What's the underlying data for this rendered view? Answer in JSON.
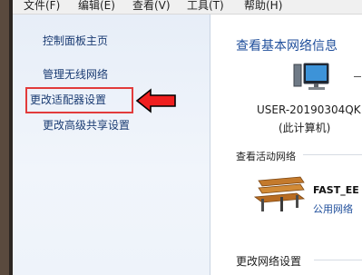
{
  "menubar": {
    "items": [
      "文件(F)",
      "编辑(E)",
      "查看(V)",
      "工具(T)",
      "帮助(H)"
    ]
  },
  "left_nav": {
    "items": [
      "控制面板主页",
      "管理无线网络",
      "更改适配器设置",
      "更改高级共享设置"
    ],
    "highlighted_index": 2
  },
  "main": {
    "title": "查看基本网络信息",
    "computer_name": "USER-20190304QK",
    "computer_note": "(此计算机)",
    "active_section": "查看活动网络",
    "network_name": "FAST_EE",
    "network_type": "公用网络",
    "change_section": "更改网络设置"
  },
  "colors": {
    "link": "#1f4e9b",
    "highlight": "#e23b3b"
  }
}
